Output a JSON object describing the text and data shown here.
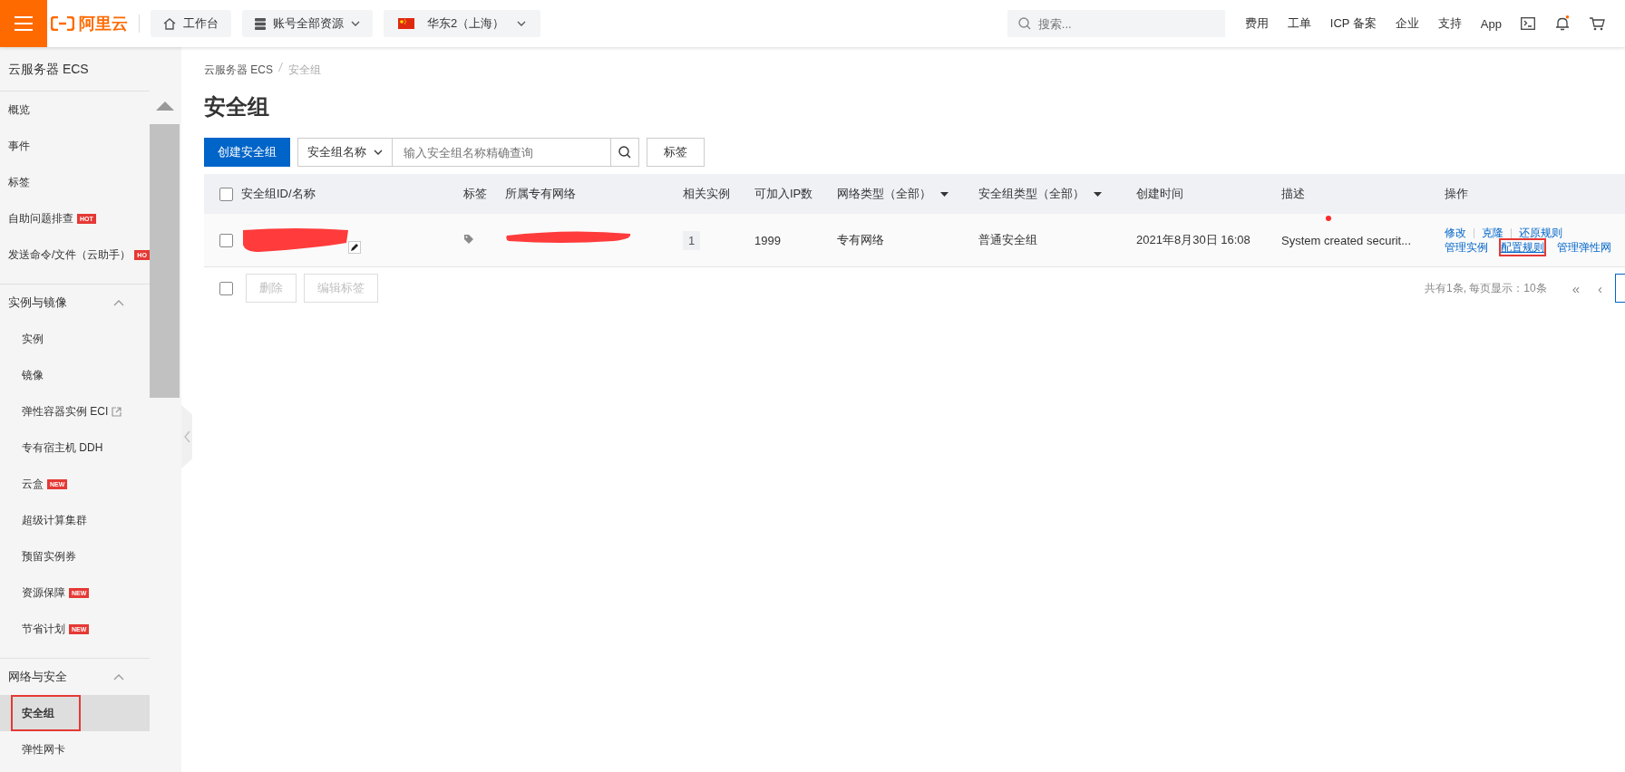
{
  "topbar": {
    "brand": "阿里云",
    "workbench": "工作台",
    "resources": "账号全部资源",
    "region": "华东2（上海）",
    "search": {
      "placeholder": "搜索..."
    },
    "links": [
      "费用",
      "工单",
      "ICP 备案",
      "企业",
      "支持",
      "App"
    ]
  },
  "sidebar": {
    "title": "云服务器 ECS",
    "items": [
      {
        "label": "概览",
        "selected": false
      },
      {
        "label": "事件",
        "selected": false
      },
      {
        "label": "标签",
        "selected": false
      },
      {
        "label": "自助问题排查",
        "selected": false,
        "badge": "HOT"
      },
      {
        "label": "发送命令/文件（云助手）",
        "selected": false,
        "badge": "HO"
      }
    ],
    "groups": [
      {
        "title": "实例与镜像",
        "expanded": true,
        "items": [
          {
            "label": "实例",
            "selected": false,
            "external": false,
            "annotated": false
          },
          {
            "label": "镜像",
            "selected": false,
            "external": false,
            "annotated": false
          },
          {
            "label": "弹性容器实例 ECI",
            "selected": false,
            "external": true,
            "annotated": false
          },
          {
            "label": "专有宿主机 DDH",
            "selected": false,
            "external": false,
            "annotated": false
          },
          {
            "label": "云盒",
            "selected": false,
            "external": false,
            "badge": "NEW",
            "annotated": false
          },
          {
            "label": "超级计算集群",
            "selected": false,
            "external": false,
            "annotated": false
          },
          {
            "label": "预留实例券",
            "selected": false,
            "external": false,
            "annotated": false
          },
          {
            "label": "资源保障",
            "selected": false,
            "external": false,
            "badge": "NEW",
            "annotated": false
          },
          {
            "label": "节省计划",
            "selected": false,
            "external": false,
            "badge": "NEW",
            "annotated": false
          }
        ]
      },
      {
        "title": "网络与安全",
        "expanded": true,
        "items": [
          {
            "label": "安全组",
            "selected": true,
            "external": false,
            "annotated": true
          },
          {
            "label": "弹性网卡",
            "selected": false,
            "external": false,
            "annotated": false
          }
        ]
      }
    ]
  },
  "breadcrumb": [
    "云服务器 ECS",
    "安全组"
  ],
  "title": "安全组",
  "toolbar": {
    "create": "创建安全组",
    "filter": "安全组名称",
    "search": {
      "placeholder": "输入安全组名称精确查询"
    },
    "tags": "标签"
  },
  "table": {
    "select_all_checked": false,
    "columns": [
      {
        "label": "安全组ID/名称",
        "filter": false
      },
      {
        "label": "标签",
        "filter": false
      },
      {
        "label": "所属专有网络",
        "filter": false
      },
      {
        "label": "相关实例",
        "filter": false
      },
      {
        "label": "可加入IP数",
        "filter": false
      },
      {
        "label": "网络类型（全部）",
        "filter": true
      },
      {
        "label": "安全组类型（全部）",
        "filter": true
      },
      {
        "label": "创建时间",
        "filter": false
      },
      {
        "label": "描述",
        "filter": false
      },
      {
        "label": "操作",
        "filter": false
      }
    ],
    "rows": [
      {
        "checked": false,
        "id_redacted": true,
        "vpc_redacted": true,
        "instances": "1",
        "ips": "1999",
        "network_type": "专有网络",
        "group_type": "普通安全组",
        "created": "2021年8月30日 16:08",
        "description": "System created securit...",
        "action_rows": [
          {
            "separated": true,
            "items": [
              {
                "label": "修改",
                "annotated": false
              },
              {
                "label": "克隆",
                "annotated": false
              },
              {
                "label": "还原规则",
                "annotated": false
              }
            ]
          },
          {
            "separated": false,
            "items": [
              {
                "label": "管理实例",
                "annotated": false
              },
              {
                "label": "配置规则",
                "annotated": true
              },
              {
                "label": "管理弹性网",
                "annotated": false
              }
            ]
          }
        ]
      }
    ]
  },
  "footer": {
    "select_all_checked": false,
    "delete": {
      "label": "删除",
      "disabled": true
    },
    "edit_tags": {
      "label": "编辑标签",
      "disabled": true
    },
    "total": "共有1条, 每页显示：10条",
    "first": "«",
    "prev": "‹"
  }
}
